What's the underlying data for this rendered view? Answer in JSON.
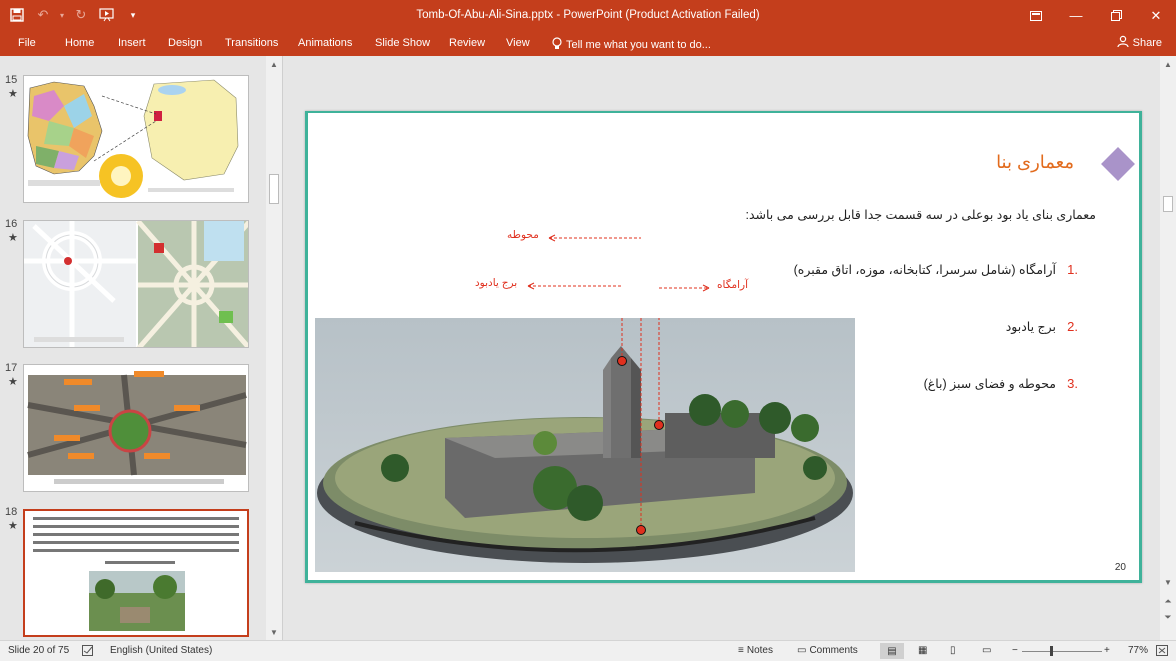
{
  "window": {
    "title": "Tomb-Of-Abu-Ali-Sina.pptx - PowerPoint (Product Activation Failed)",
    "share_label": "Share"
  },
  "ribbon": {
    "tabs": [
      "File",
      "Home",
      "Insert",
      "Design",
      "Transitions",
      "Animations",
      "Slide Show",
      "Review",
      "View"
    ],
    "tell_me": "Tell me what you want to do..."
  },
  "thumbnails": [
    {
      "number": "15",
      "star": "★"
    },
    {
      "number": "16",
      "star": "★"
    },
    {
      "number": "17",
      "star": "★"
    },
    {
      "number": "18",
      "star": "★"
    }
  ],
  "slide": {
    "title": "معماری بنا",
    "intro": "معماری بنای یاد بود بوعلی در سه قسمت جدا قابل بررسی می باشد:",
    "items": [
      {
        "num": "1.",
        "text": "آرامگاه (شامل سرسرا، کتابخانه، موزه، اتاق مقبره)"
      },
      {
        "num": "2.",
        "text": "برج یادبود"
      },
      {
        "num": "3.",
        "text": "محوطه و فضای سبز (باغ)"
      }
    ],
    "labels": {
      "courtyard": "محوطه",
      "tower": "برج یادبود",
      "tomb": "آرامگاه"
    },
    "page_number": "20"
  },
  "status": {
    "slide_info": "Slide 20 of 75",
    "language": "English (United States)",
    "notes": "Notes",
    "comments": "Comments",
    "zoom": "77%"
  },
  "colors": {
    "accent": "#c43e1c",
    "frame": "#3fb29a",
    "title": "#e26b1d",
    "red": "#e0301e",
    "diamond": "#a993c9"
  }
}
